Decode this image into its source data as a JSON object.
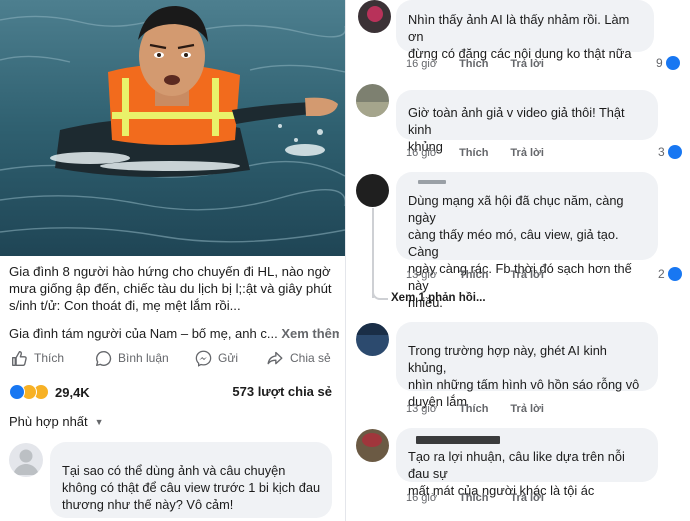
{
  "post": {
    "text": "Gia đình 8 người hào hứng cho chuyến đi HL, nào ngờ mưa giống ập đến, chiếc tàu du lịch bị l;:ật và giây phút s/inh t/ử: Con thoát đi, mẹ mệt lắm rồi...",
    "text2": "Gia đình tám người của Nam – bố mẹ, anh c...",
    "see_more": "Xem thêm",
    "actions": {
      "like": "Thích",
      "comment": "Bình luận",
      "send": "Gửi",
      "share": "Chia sẻ"
    },
    "reaction_count": "29,4K",
    "share_count": "573 lượt chia sẻ",
    "sort_label": "Phù hợp nhất",
    "first_comment": "Tại sao có thể dùng ảnh và câu chuyện không có thật để câu view trước 1 bi kịch đau thương như thế này? Vô cảm!"
  },
  "comments": [
    {
      "text_lines": [
        "Nhìn thấy ảnh AI là thấy nhảm rồi. Làm ơn",
        "đừng có đăng các nội dung ko thật nữa"
      ],
      "time": "16 giờ",
      "like": "Thích",
      "reply": "Trả lời",
      "likes": "9"
    },
    {
      "text_lines": [
        "Giờ toàn ảnh giả v video giả thôi! Thật kinh",
        "khủng"
      ],
      "time": "16 giờ",
      "like": "Thích",
      "reply": "Trả lời",
      "likes": "3"
    },
    {
      "text_lines": [
        "Dùng mạng xã hội đã chục năm, càng ngày",
        "càng thấy méo mó, câu view, giả tạo. Càng",
        "ngày càng rác. Fb thời đó sạch hơn thế này",
        "nhiều."
      ],
      "time": "13 giờ",
      "like": "Thích",
      "reply": "Trả lời",
      "likes": "2"
    },
    {
      "text_lines": [
        "Trong trường hợp này, ghét AI kinh khủng,",
        "nhìn những tấm hình vô hồn sáo rỗng vô",
        "duyên lắm"
      ],
      "time": "13 giờ",
      "like": "Thích",
      "reply": "Trả lời",
      "likes": ""
    },
    {
      "text_lines": [
        "Tạo ra lợi nhuận, câu like dựa trên nỗi đau sự",
        "mất mát của người khác là tội ác"
      ],
      "time": "16 giờ",
      "like": "Thích",
      "reply": "Trả lời",
      "likes": ""
    }
  ],
  "see_replies": "Xem 1 phản hồi...",
  "colors": {
    "accent": "#1877f2",
    "bubble": "#f0f2f5",
    "meta": "#65676b",
    "vest": "#f26b1d"
  }
}
